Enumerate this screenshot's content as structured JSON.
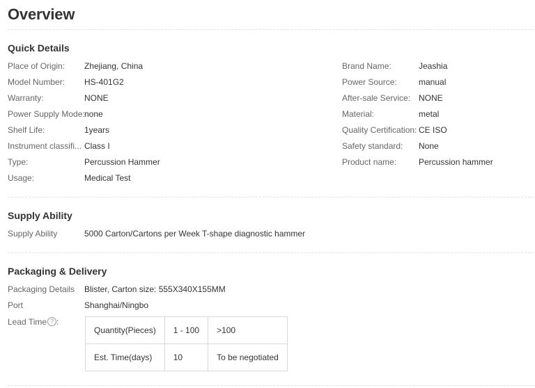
{
  "overview": {
    "title": "Overview"
  },
  "quick_details": {
    "title": "Quick Details",
    "left": [
      {
        "label": "Place of Origin:",
        "value": "Zhejiang, China"
      },
      {
        "label": "Model Number:",
        "value": "HS-401G2"
      },
      {
        "label": "Warranty:",
        "value": "NONE"
      },
      {
        "label": "Power Supply Mode:",
        "value": "none"
      },
      {
        "label": "Shelf Life:",
        "value": "1years"
      },
      {
        "label": "Instrument classifi...",
        "value": "Class I"
      },
      {
        "label": "Type:",
        "value": "Percussion Hammer"
      },
      {
        "label": "Usage:",
        "value": "Medical Test"
      }
    ],
    "right": [
      {
        "label": "Brand Name:",
        "value": "Jeashia"
      },
      {
        "label": "Power Source:",
        "value": "manual"
      },
      {
        "label": "After-sale Service:",
        "value": "NONE"
      },
      {
        "label": "Material:",
        "value": "metal"
      },
      {
        "label": "Quality Certification:",
        "value": "CE ISO"
      },
      {
        "label": "Safety standard:",
        "value": "None"
      },
      {
        "label": "Product name:",
        "value": "Percussion hammer"
      }
    ]
  },
  "supply_ability": {
    "title": "Supply Ability",
    "label": "Supply Ability",
    "value": "5000 Carton/Cartons per Week T-shape diagnostic hammer"
  },
  "packaging": {
    "title": "Packaging & Delivery",
    "details_label": "Packaging Details",
    "details_value": "Blister, Carton size: 555X340X155MM",
    "port_label": "Port",
    "port_value": "Shanghai/Ningbo",
    "lead_time_label": "Lead Time",
    "lead_time_suffix": ":",
    "help_icon_glyph": "?",
    "lead_table": {
      "quantity_header": "Quantity(Pieces)",
      "time_header": "Est. Time(days)",
      "columns": [
        {
          "quantity": "1 - 100",
          "time": "10"
        },
        {
          "quantity": ">100",
          "time": "To be negotiated"
        }
      ]
    }
  }
}
